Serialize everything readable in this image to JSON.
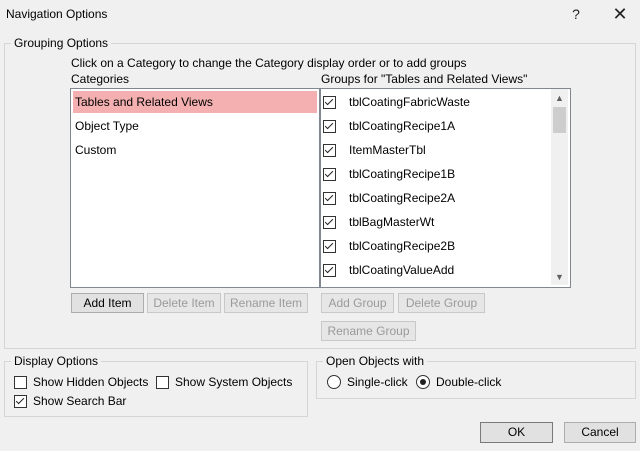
{
  "window": {
    "title": "Navigation Options",
    "help_glyph": "?",
    "close_glyph": "✕"
  },
  "grouping": {
    "label": "Grouping Options",
    "hint": "Click on a Category to change the Category display order or to add groups",
    "categories_label": "Categories",
    "groups_label": "Groups for \"Tables and Related Views\"",
    "categories": [
      {
        "label": "Tables and Related Views",
        "selected": true
      },
      {
        "label": "Object Type",
        "selected": false
      },
      {
        "label": "Custom",
        "selected": false
      }
    ],
    "groups": [
      {
        "label": "tblCoatingFabricWaste",
        "checked": true
      },
      {
        "label": "tblCoatingRecipe1A",
        "checked": true
      },
      {
        "label": "ItemMasterTbl",
        "checked": true
      },
      {
        "label": "tblCoatingRecipe1B",
        "checked": true
      },
      {
        "label": "tblCoatingRecipe2A",
        "checked": true
      },
      {
        "label": "tblBagMasterWt",
        "checked": true
      },
      {
        "label": "tblCoatingRecipe2B",
        "checked": true
      },
      {
        "label": "tblCoatingValueAdd",
        "checked": true
      }
    ],
    "buttons": {
      "add_item": "Add Item",
      "delete_item": "Delete Item",
      "rename_item": "Rename Item",
      "add_group": "Add Group",
      "delete_group": "Delete Group",
      "rename_group": "Rename Group"
    }
  },
  "display": {
    "label": "Display Options",
    "show_hidden": {
      "label": "Show Hidden Objects",
      "checked": false
    },
    "show_system": {
      "label": "Show System Objects",
      "checked": false
    },
    "show_search": {
      "label": "Show Search Bar",
      "checked": true
    }
  },
  "open_with": {
    "label": "Open Objects with",
    "single": {
      "label": "Single-click",
      "checked": false
    },
    "double": {
      "label": "Double-click",
      "checked": true
    }
  },
  "footer": {
    "ok": "OK",
    "cancel": "Cancel"
  },
  "icons": {
    "up_arrow": "chevron-up-icon",
    "down_arrow": "chevron-down-icon"
  }
}
